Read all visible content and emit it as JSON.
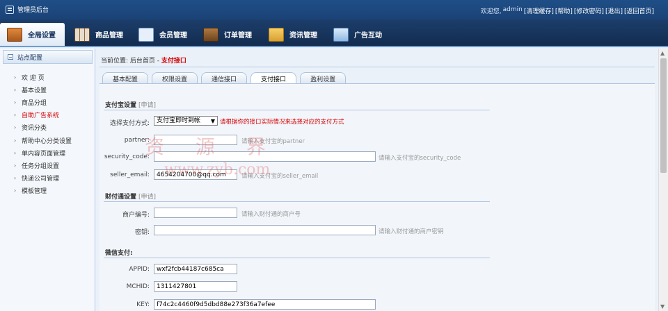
{
  "topbar": {
    "title": "管理员后台",
    "welcome": "欢迎您,",
    "user": "admin",
    "links": [
      "[清理缓存]",
      "[帮助]",
      "[修改密码]",
      "[退出]",
      "[返回首页]"
    ]
  },
  "mainnav": [
    {
      "label": "全局设置",
      "icon": "settings-icon",
      "color": "#c8702c"
    },
    {
      "label": "商品管理",
      "icon": "grid-icon",
      "color": "#d8cbb7"
    },
    {
      "label": "会员管理",
      "icon": "member-card-icon",
      "color": "#cfe0f3"
    },
    {
      "label": "订单管理",
      "icon": "wallet-icon",
      "color": "#8a5a2a"
    },
    {
      "label": "资讯管理",
      "icon": "folder-icon",
      "color": "#e7b642"
    },
    {
      "label": "广告互动",
      "icon": "screen-icon",
      "color": "#b7d4f2"
    }
  ],
  "sidebar": {
    "heading": "站点配置",
    "items": [
      {
        "label": "欢 迎 页"
      },
      {
        "label": "基本设置"
      },
      {
        "label": "商品分组"
      },
      {
        "label": "自助广告系统"
      },
      {
        "label": "资讯分类"
      },
      {
        "label": "帮助中心分类设置"
      },
      {
        "label": "单内容页面管理"
      },
      {
        "label": "任务分组设置"
      },
      {
        "label": "快递公司管理"
      },
      {
        "label": "模板管理"
      }
    ]
  },
  "breadcrumb": {
    "prefix": "当前位置:",
    "home": "后台首页",
    "sep": " - ",
    "current": "支付接口"
  },
  "tabs": [
    "基本配置",
    "权限设置",
    "通信接口",
    "支付接口",
    "盈利设置"
  ],
  "alipay": {
    "title": "支付宝设置",
    "tag": "[申请]",
    "method_label": "选择支付方式:",
    "method_value": "支付宝即时到帐",
    "method_warning": "请根据你的接口实际情况来选择对应的支付方式",
    "partner_label": "partner:",
    "partner_value": "",
    "partner_hint": "请输入支付宝的partner",
    "code_label": "security_code:",
    "code_value": "",
    "code_hint": "请输入支付宝的security_code",
    "email_label": "seller_email:",
    "email_value": "4654204700@qq.com",
    "email_hint": "请输入支付宝的seller_email"
  },
  "tenpay": {
    "title": "财付通设置",
    "tag": "[申请]",
    "merchant_label": "商户编号:",
    "merchant_value": "",
    "merchant_hint": "请输入财付通的商户号",
    "key_label": "密钥:",
    "key_value": "",
    "key_hint": "请输入财付通的商户密钥"
  },
  "wechat": {
    "title": "微信支付:",
    "appid_label": "APPID:",
    "appid_value": "wxf2fcb44187c685ca",
    "mchid_label": "MCHID:",
    "mchid_value": "1311427801",
    "key_label": "KEY:",
    "key_value": "f74c2c4460f9d5dbd88e273f36a7efee"
  },
  "watermark": {
    "line1": "资 源 界",
    "line2": "www.zyb.com"
  }
}
